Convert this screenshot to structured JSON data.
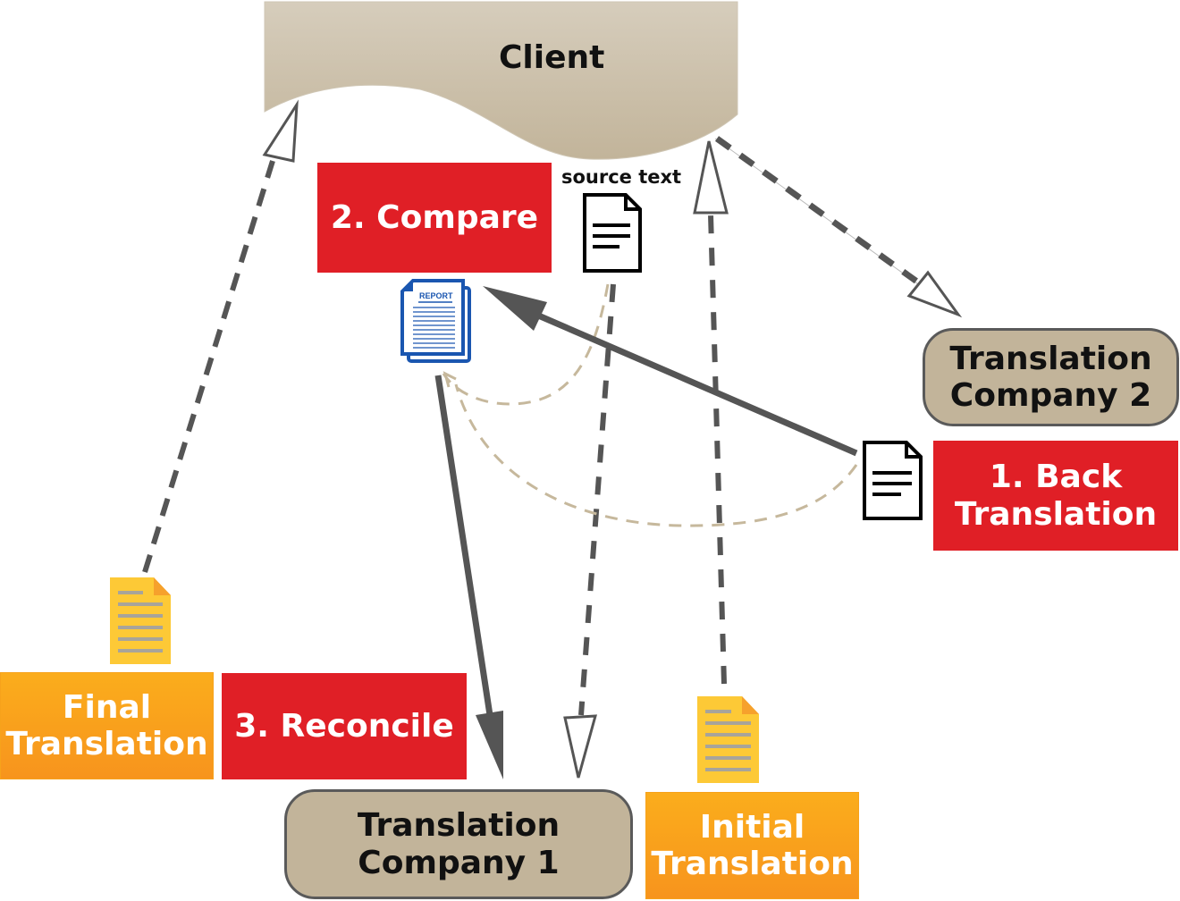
{
  "diagram": {
    "client": {
      "label": "Client",
      "fill_top": "#d6cdbc",
      "fill_bottom": "#c2b49a"
    },
    "steps": {
      "compare": {
        "label": "2. Compare",
        "color": "#e01f26"
      },
      "back_translation": {
        "label_line1": "1. Back",
        "label_line2": "Translation",
        "color": "#e01f26"
      },
      "reconcile": {
        "label": "3. Reconcile",
        "color": "#e01f26"
      }
    },
    "companies": {
      "company1": {
        "label_line1": "Translation",
        "label_line2": "Company 1"
      },
      "company2": {
        "label_line1": "Translation",
        "label_line2": "Company 2"
      }
    },
    "outputs": {
      "final": {
        "label_line1": "Final",
        "label_line2": "Translation",
        "color": "#f7a21b"
      },
      "initial": {
        "label_line1": "Initial",
        "label_line2": "Translation",
        "color": "#f7a21b"
      }
    },
    "documents": {
      "source_text": {
        "label": "source text",
        "icon": "document-icon"
      },
      "report": {
        "label": "REPORT",
        "icon": "report-icon",
        "color": "#1a56b0"
      },
      "back_doc": {
        "icon": "document-icon"
      },
      "final_doc": {
        "icon": "yellow-document-icon"
      },
      "initial_doc": {
        "icon": "yellow-document-icon"
      }
    },
    "connectors": [
      {
        "from": "final-translation",
        "to": "client",
        "style": "dashed",
        "head": "open"
      },
      {
        "from": "client",
        "to": "translation-company-2",
        "style": "dashed",
        "head": "open"
      },
      {
        "from": "initial-translation",
        "to": "client",
        "style": "dashed",
        "head": "open"
      },
      {
        "from": "source-text",
        "to": "translation-company-1",
        "style": "dashed",
        "head": "open"
      },
      {
        "from": "back-translation-doc",
        "to": "report",
        "style": "solid",
        "head": "filled"
      },
      {
        "from": "report",
        "to": "translation-company-1",
        "style": "solid",
        "head": "filled"
      },
      {
        "from": "source-text",
        "to": "report",
        "style": "dashed-tan",
        "head": "none"
      },
      {
        "from": "back-translation-doc",
        "to": "report",
        "style": "dashed-tan",
        "head": "open"
      }
    ]
  }
}
